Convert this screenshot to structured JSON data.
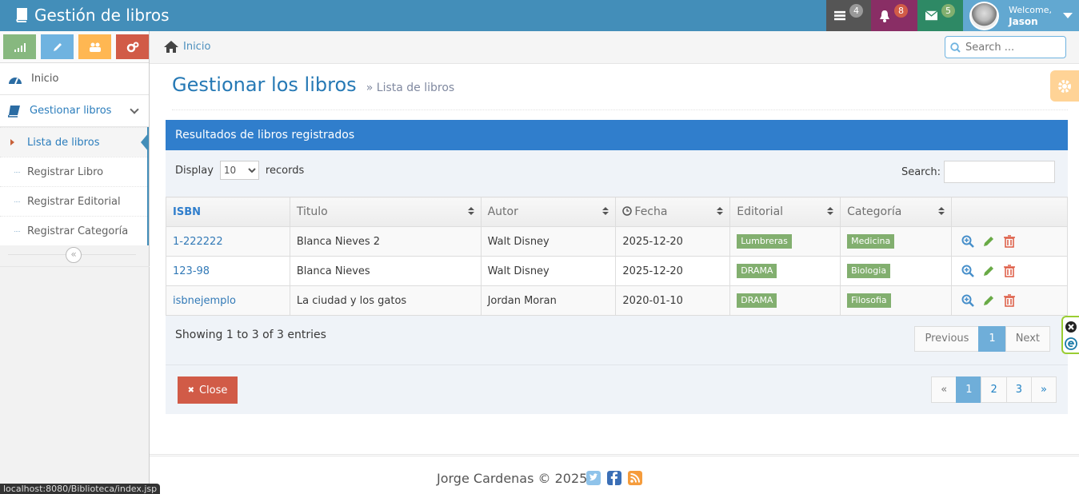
{
  "app": {
    "title": "Gestión de libros"
  },
  "navbar": {
    "tasks_count": "4",
    "notifications_count": "8",
    "messages_count": "5",
    "welcome_label": "Welcome,",
    "user_name": "Jason"
  },
  "sidebar": {
    "items": [
      {
        "label": "Inicio"
      },
      {
        "label": "Gestionar libros"
      }
    ],
    "submenu": [
      {
        "label": "Lista de libros"
      },
      {
        "label": "Registrar Libro"
      },
      {
        "label": "Registrar Editorial"
      },
      {
        "label": "Registrar Categoría"
      }
    ],
    "collapse_glyph": "«"
  },
  "breadcrumb": {
    "home_label": "Inicio"
  },
  "search": {
    "placeholder": "Search ..."
  },
  "page": {
    "title": "Gestionar los libros",
    "subtitle": "» Lista de libros"
  },
  "widget": {
    "header": "Resultados de libros registrados",
    "display_label": "Display",
    "display_value": "10",
    "records_label": "records",
    "search_label": "Search:"
  },
  "table": {
    "columns": [
      "ISBN",
      "Titulo",
      "Autor",
      "Fecha",
      "Editorial",
      "Categoría"
    ],
    "rows": [
      {
        "isbn": "1-222222",
        "titulo": "Blanca Nieves 2",
        "autor": "Walt Disney",
        "fecha": "2025-12-20",
        "editorial": "Lumbreras",
        "categoria": "Medicina"
      },
      {
        "isbn": "123-98",
        "titulo": "Blanca Nieves",
        "autor": "Walt Disney",
        "fecha": "2025-12-20",
        "editorial": "DRAMA",
        "categoria": "Biologia"
      },
      {
        "isbn": "isbnejemplo",
        "titulo": "La ciudad y los gatos",
        "autor": "Jordan Moran",
        "fecha": "2020-01-10",
        "editorial": "DRAMA",
        "categoria": "Filosofia"
      }
    ]
  },
  "pagination": {
    "info": "Showing 1 to 3 of 3 entries",
    "previous": "Previous",
    "current": "1",
    "next": "Next"
  },
  "bottom_pagination": {
    "first": "«",
    "pages": [
      "1",
      "2",
      "3"
    ],
    "last": "»"
  },
  "close_button": {
    "label": "Close",
    "icon_glyph": "✖"
  },
  "footer": {
    "copyright": "Jorge Cardenas © 2025"
  },
  "status_bar": {
    "url": "localhost:8080/Biblioteca/index.jsp"
  },
  "colors": {
    "navbar": "#438eb9",
    "widget_header": "#307ecc",
    "tag_green": "#82af6f",
    "danger": "#d15b47"
  }
}
